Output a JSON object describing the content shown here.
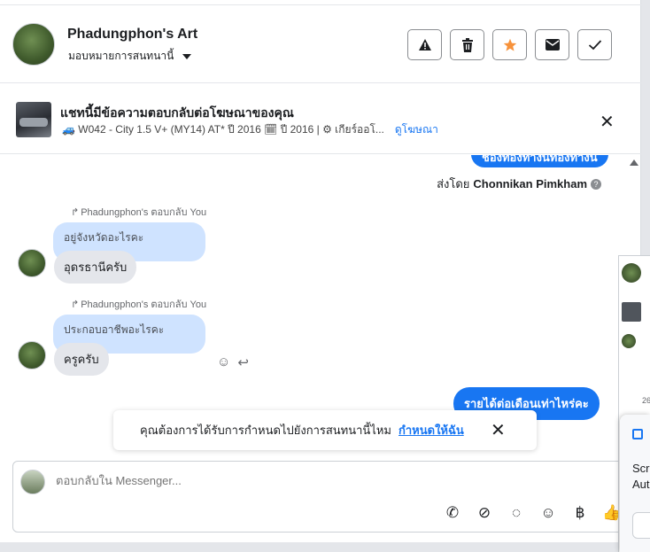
{
  "header": {
    "page_name": "Phadungphon's Art",
    "assign_label": "มอบหมายการสนทนานี้",
    "icons": [
      "warning-icon",
      "trash-icon",
      "star-icon",
      "envelope-icon",
      "check-icon"
    ],
    "star_color": "#f7923b"
  },
  "ad": {
    "title": "แชทนี้มีข้อความตอบกลับต่อโฆษณาของคุณ",
    "subtitle": "🚙 W042 - City 1.5 V+ (MY14) AT* ปี 2016 🗓 ปี 2016 | ⚙ เกียร์ออโ...",
    "link": "ดูโฆษณา"
  },
  "thread": {
    "top_partial_bubble": "ช่องทองทางนทองทางน",
    "sent_by_prefix": "ส่งโดย",
    "sent_by_name": "Chonnikan Pimkham",
    "replies": [
      {
        "note": "Phadungphon's ตอบกลับ You",
        "quoted": "อยู่จังหวัดอะไรคะ",
        "text": "อุดรธานีครับ"
      },
      {
        "note": "Phadungphon's ตอบกลับ You",
        "quoted": "ประกอบอาชีพอะไรคะ",
        "text": "ครูครับ"
      }
    ],
    "outgoing_last": "รายได้ต่อเดือนเท่าไหร่คะ"
  },
  "toast": {
    "text": "คุณต้องการได้รับการกำหนดไปยังการสนทนานี้ไหม",
    "link": "กำหนดให้ฉัน"
  },
  "composer": {
    "placeholder": "ตอบกลับใน Messenger...",
    "tools": [
      "phone-add-icon",
      "paperclip-icon",
      "chat-bubble-icon",
      "emoji-icon",
      "baht-icon",
      "thumbs-up-icon"
    ],
    "baht_symbol": "฿"
  },
  "side_panel": {
    "peek_text_1": "Scr",
    "peek_text_2": "Aut",
    "peek_date": "26"
  },
  "colors": {
    "accent": "#1876f2",
    "quoted_bg": "#cfe3ff",
    "bubble_gray": "#e4e6eb"
  }
}
